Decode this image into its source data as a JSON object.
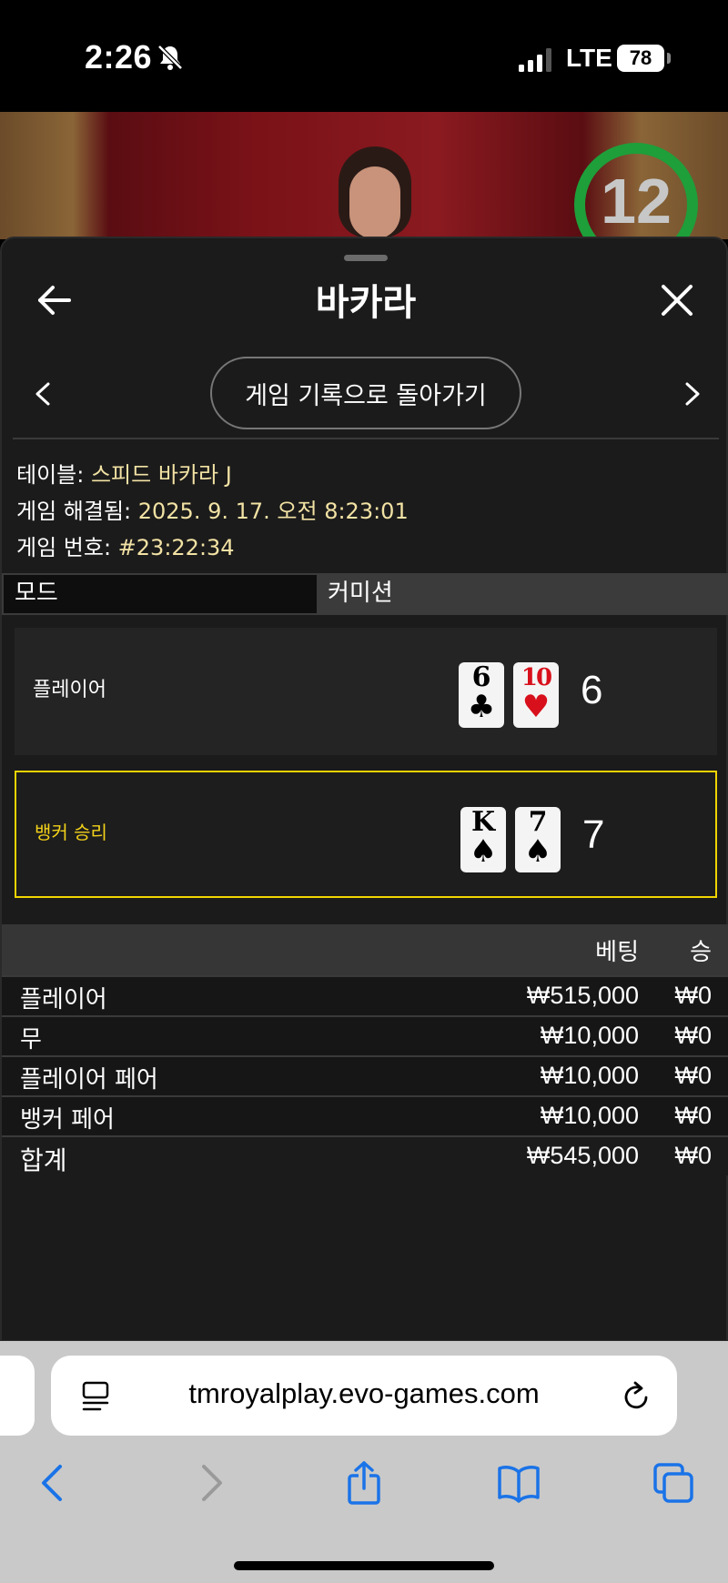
{
  "status_bar": {
    "time": "2:26",
    "network": "LTE",
    "battery": "78",
    "silent_icon": "bell-slash-icon"
  },
  "video": {
    "timer": "12",
    "timer_color": "#1e9f3a"
  },
  "header": {
    "title": "바카라",
    "back_icon": "arrow-left-icon",
    "close_icon": "close-icon"
  },
  "navigation": {
    "back_to_history": "게임 기록으로 돌아가기"
  },
  "game_info": {
    "table_label": "테이블: ",
    "table_value": "스피드 바카라 J",
    "resolved_label": "게임 해결됨: ",
    "resolved_value": "2025. 9. 17. 오전 8:23:01",
    "number_label": "게임 번호: ",
    "number_value": "#23:22:34"
  },
  "mode": {
    "label": "모드",
    "value": "커미션"
  },
  "hands": {
    "player": {
      "label": "플레이어",
      "cards": [
        {
          "rank": "6",
          "suit": "♣",
          "color": "#000000"
        },
        {
          "rank": "10",
          "suit": "♥",
          "color": "#d8101c"
        }
      ],
      "total": "6"
    },
    "banker": {
      "label": "뱅커 승리",
      "highlight_color": "#f0d400",
      "cards": [
        {
          "rank": "K",
          "suit": "♠",
          "color": "#000000"
        },
        {
          "rank": "7",
          "suit": "♠",
          "color": "#000000"
        }
      ],
      "total": "7"
    }
  },
  "bets": {
    "header_bet": "베팅",
    "header_win": "승",
    "rows": [
      {
        "name": "플레이어",
        "bet": "₩515,000",
        "win": "₩0"
      },
      {
        "name": "무",
        "bet": "₩10,000",
        "win": "₩0"
      },
      {
        "name": "플레이어 페어",
        "bet": "₩10,000",
        "win": "₩0"
      },
      {
        "name": "뱅커 페어",
        "bet": "₩10,000",
        "win": "₩0"
      }
    ],
    "total": {
      "name": "합계",
      "bet": "₩545,000",
      "win": "₩0"
    }
  },
  "browser": {
    "url": "tmroyalplay.evo-games.com",
    "accent": "#1a73e8"
  }
}
